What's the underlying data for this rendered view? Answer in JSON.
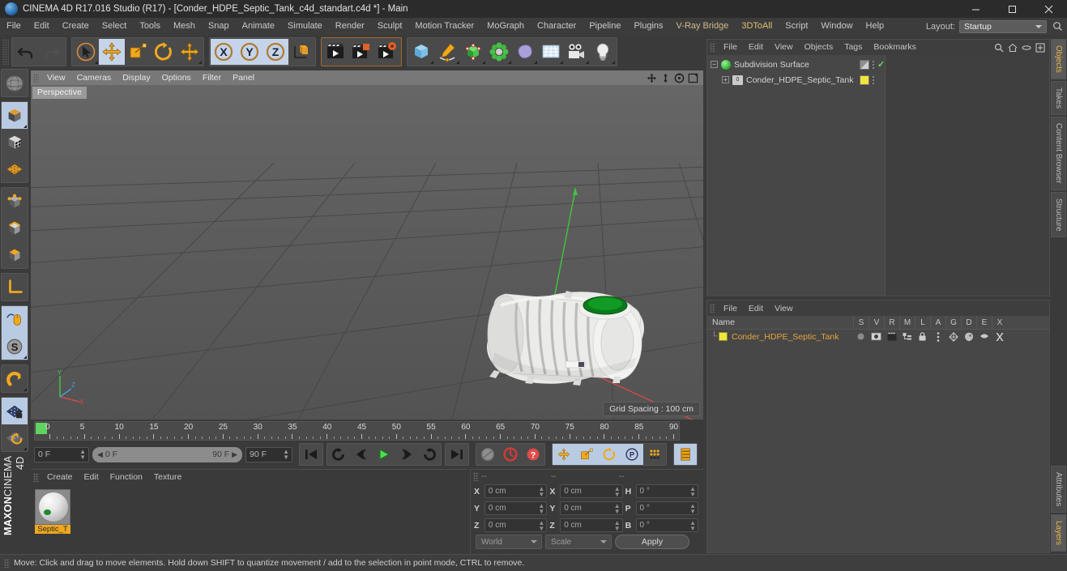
{
  "window": {
    "title": "CINEMA 4D R17.016 Studio (R17) - [Conder_HDPE_Septic_Tank_c4d_standart.c4d *] - Main",
    "minimize": "–",
    "maximize": "□",
    "close": "✕"
  },
  "menubar": {
    "items": [
      {
        "label": "File"
      },
      {
        "label": "Edit"
      },
      {
        "label": "Create"
      },
      {
        "label": "Select"
      },
      {
        "label": "Tools"
      },
      {
        "label": "Mesh"
      },
      {
        "label": "Snap"
      },
      {
        "label": "Animate"
      },
      {
        "label": "Simulate"
      },
      {
        "label": "Render"
      },
      {
        "label": "Sculpt"
      },
      {
        "label": "Motion Tracker"
      },
      {
        "label": "MoGraph"
      },
      {
        "label": "Character"
      },
      {
        "label": "Pipeline"
      },
      {
        "label": "Plugins"
      },
      {
        "label": "V-Ray Bridge"
      },
      {
        "label": "3DToAll"
      },
      {
        "label": "Script"
      },
      {
        "label": "Window"
      },
      {
        "label": "Help"
      }
    ],
    "layout_label": "Layout:",
    "layout_value": "Startup"
  },
  "toolbar": {
    "groups": [
      {
        "buttons": [
          {
            "name": "undo-button",
            "state": "normal"
          },
          {
            "name": "redo-button",
            "state": "disabled"
          }
        ]
      },
      {
        "buttons": [
          {
            "name": "select-tool-button",
            "state": "normal"
          },
          {
            "name": "move-tool-button",
            "state": "selected"
          },
          {
            "name": "scale-tool-button",
            "state": "normal"
          },
          {
            "name": "rotate-tool-button",
            "state": "normal"
          },
          {
            "name": "move-axis-button",
            "state": "normal"
          }
        ]
      },
      {
        "buttons": [
          {
            "name": "x-axis-lock-button",
            "state": "selected"
          },
          {
            "name": "y-axis-lock-button",
            "state": "selected"
          },
          {
            "name": "z-axis-lock-button",
            "state": "selected"
          },
          {
            "name": "world-object-coordinate-button",
            "state": "normal"
          }
        ]
      },
      {
        "buttons": [
          {
            "name": "render-view-button",
            "state": "normal"
          },
          {
            "name": "render-region-button",
            "state": "normal"
          },
          {
            "name": "render-settings-button",
            "state": "normal"
          }
        ]
      },
      {
        "buttons": [
          {
            "name": "cube-primitive-button",
            "state": "normal"
          },
          {
            "name": "spline-pen-button",
            "state": "normal"
          },
          {
            "name": "generator-button",
            "state": "normal"
          },
          {
            "name": "deformer-button",
            "state": "normal"
          },
          {
            "name": "environment-button",
            "state": "normal"
          },
          {
            "name": "floor-sky-button",
            "state": "normal"
          },
          {
            "name": "camera-button",
            "state": "normal"
          },
          {
            "name": "light-button",
            "state": "normal"
          }
        ]
      }
    ]
  },
  "lefttools": {
    "groups": [
      {
        "buttons": [
          {
            "name": "make-editable-button",
            "state": "normal"
          }
        ]
      },
      {
        "buttons": [
          {
            "name": "model-mode-button",
            "state": "selected"
          },
          {
            "name": "texture-mode-button",
            "state": "normal"
          },
          {
            "name": "workplane-mode-button",
            "state": "normal"
          }
        ]
      },
      {
        "buttons": [
          {
            "name": "points-mode-button",
            "state": "normal"
          },
          {
            "name": "edges-mode-button",
            "state": "normal"
          },
          {
            "name": "polygons-mode-button",
            "state": "normal"
          }
        ]
      },
      {
        "buttons": [
          {
            "name": "enable-axis-modification-button",
            "state": "normal"
          }
        ]
      },
      {
        "buttons": [
          {
            "name": "viewport-solo-button",
            "state": "selected"
          },
          {
            "name": "enable-snap-button",
            "state": "selected"
          }
        ]
      },
      {
        "buttons": [
          {
            "name": "magnet-tool-button",
            "state": "normal"
          }
        ]
      },
      {
        "buttons": [
          {
            "name": "workplane-lock-button",
            "state": "selected"
          },
          {
            "name": "workplane-rotate-button",
            "state": "normal"
          }
        ]
      }
    ],
    "brand_bold": "MAXON",
    "brand_thin": "CINEMA 4D"
  },
  "viewport": {
    "menu": [
      {
        "label": "View"
      },
      {
        "label": "Cameras"
      },
      {
        "label": "Display"
      },
      {
        "label": "Options"
      },
      {
        "label": "Filter"
      },
      {
        "label": "Panel"
      }
    ],
    "nav_icons": [
      {
        "name": "viewport-pan-icon"
      },
      {
        "name": "viewport-dolly-icon"
      },
      {
        "name": "viewport-rotate-icon"
      },
      {
        "name": "viewport-maximize-icon"
      }
    ],
    "label": "Perspective",
    "grid_spacing": "Grid Spacing : 100 cm",
    "axis_labels": {
      "x": "X",
      "y": "Y",
      "z": "Z"
    }
  },
  "timeline": {
    "ticks": [
      "0",
      "5",
      "10",
      "15",
      "20",
      "25",
      "30",
      "35",
      "40",
      "45",
      "50",
      "55",
      "60",
      "65",
      "70",
      "75",
      "80",
      "85",
      "90"
    ],
    "current_frame": "0 F",
    "range_start": "0 F",
    "range_end": "90 F",
    "max_frame": "90 F",
    "end_field": "0 F",
    "controls": [
      {
        "name": "go-to-start-button",
        "state": "normal"
      },
      {
        "name": "play-reverse-button",
        "state": "normal"
      },
      {
        "name": "previous-frame-button",
        "state": "normal"
      },
      {
        "name": "play-forward-button",
        "state": "normal"
      },
      {
        "name": "next-frame-button",
        "state": "normal"
      },
      {
        "name": "play-loop-button",
        "state": "normal"
      },
      {
        "name": "go-to-end-button",
        "state": "normal"
      }
    ],
    "record_controls": [
      {
        "name": "record-active-objects-button",
        "state": "disabled"
      },
      {
        "name": "autokeying-button",
        "state": "normal"
      },
      {
        "name": "keyframe-selection-button",
        "state": "normal"
      }
    ],
    "key_toggles": [
      {
        "name": "position-key-button",
        "state": "selected"
      },
      {
        "name": "scale-key-button",
        "state": "selected"
      },
      {
        "name": "rotation-key-button",
        "state": "selected"
      },
      {
        "name": "parameter-key-button",
        "state": "selected"
      },
      {
        "name": "point-level-animation-button",
        "state": "normal"
      }
    ],
    "extra": [
      {
        "name": "timeline-filter-button",
        "state": "selected"
      }
    ]
  },
  "material_manager": {
    "menu": [
      {
        "label": "Create"
      },
      {
        "label": "Edit"
      },
      {
        "label": "Function"
      },
      {
        "label": "Texture"
      }
    ],
    "materials": [
      {
        "name": "Septic_T"
      }
    ]
  },
  "coordinate_manager": {
    "headers": [
      "--",
      "--",
      "--"
    ],
    "rows": [
      {
        "pos_label": "X",
        "pos_value": "0 cm",
        "size_label": "X",
        "size_value": "0 cm",
        "rot_label": "H",
        "rot_value": "0 °"
      },
      {
        "pos_label": "Y",
        "pos_value": "0 cm",
        "size_label": "Y",
        "size_value": "0 cm",
        "rot_label": "P",
        "rot_value": "0 °"
      },
      {
        "pos_label": "Z",
        "pos_value": "0 cm",
        "size_label": "Z",
        "size_value": "0 cm",
        "rot_label": "B",
        "rot_value": "0 °"
      }
    ],
    "coord_system": "World",
    "size_mode": "Scale",
    "apply_label": "Apply"
  },
  "object_manager": {
    "menu": [
      {
        "label": "File"
      },
      {
        "label": "Edit"
      },
      {
        "label": "View"
      },
      {
        "label": "Objects"
      },
      {
        "label": "Tags"
      },
      {
        "label": "Bookmarks"
      }
    ],
    "header_icons": [
      {
        "name": "search-icon"
      },
      {
        "name": "home-icon"
      },
      {
        "name": "link-icon"
      },
      {
        "name": "new-tab-icon"
      }
    ],
    "rows": [
      {
        "name": "Subdivision Surface",
        "icon": "subdivision-surface-icon",
        "expander": "−",
        "depth": 0,
        "tag_color": "",
        "has_check": true
      },
      {
        "name": "Conder_HDPE_Septic_Tank",
        "icon": "null-object-icon",
        "icon_text": "0",
        "expander": "+",
        "depth": 1,
        "tag_color": "#f2e43a",
        "has_check": false
      }
    ]
  },
  "layer_manager": {
    "menu": [
      {
        "label": "File"
      },
      {
        "label": "Edit"
      },
      {
        "label": "View"
      }
    ],
    "name_column": "Name",
    "columns": [
      "S",
      "V",
      "R",
      "M",
      "L",
      "A",
      "G",
      "D",
      "E",
      "X"
    ],
    "rows": [
      {
        "name": "Conder_HDPE_Septic_Tank",
        "swatch": "#f2e43a"
      }
    ]
  },
  "vertical_tabs": [
    {
      "label": "Objects",
      "active": true
    },
    {
      "label": "Takes",
      "active": false
    },
    {
      "label": "Content Browser",
      "active": false
    },
    {
      "label": "Structure",
      "active": false
    },
    {
      "label": "Attributes",
      "active": false
    },
    {
      "label": "Layers",
      "active": true
    }
  ],
  "statusbar": {
    "text": "Move: Click and drag to move elements. Hold down SHIFT to quantize movement / add to the selection in point mode, CTRL to remove."
  },
  "colors": {
    "accent_orange": "#f0a81e",
    "selection_blue": "#b9cbe2",
    "tag_yellow": "#f2e43a",
    "green": "#3fc03f"
  }
}
